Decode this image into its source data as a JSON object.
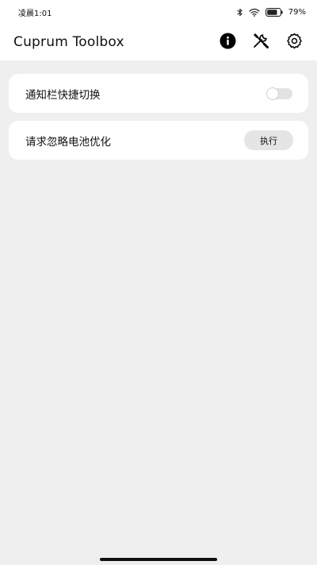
{
  "status_bar": {
    "time": "凌晨1:01",
    "battery_percent": "79%",
    "battery_level": 0.79,
    "icons": [
      "bluetooth-icon",
      "wifi-icon",
      "battery-icon"
    ]
  },
  "app_bar": {
    "title": "Cuprum Toolbox",
    "actions": [
      "info-icon",
      "tools-icon",
      "settings-gear-icon"
    ]
  },
  "settings": {
    "notification_toggle": {
      "label": "通知栏快捷切换",
      "enabled": false
    },
    "battery_optimization": {
      "label": "请求忽略电池优化",
      "button_label": "执行"
    }
  },
  "colors": {
    "background": "#efefef",
    "card": "#ffffff",
    "button": "#e5e5e5",
    "toggle_track": "#e3e3e3"
  }
}
